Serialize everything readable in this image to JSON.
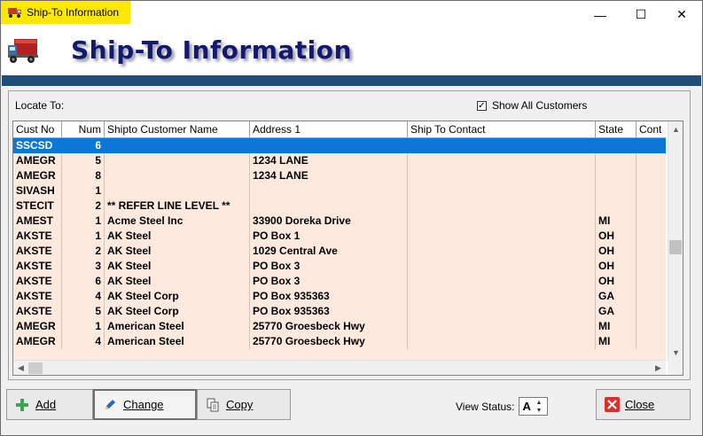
{
  "window": {
    "title": "Ship-To Information",
    "controls": {
      "minimize": "—",
      "maximize": "☐",
      "close": "✕"
    }
  },
  "header": {
    "title": "Ship-To Information"
  },
  "panel": {
    "locate_label": "Locate To:",
    "show_all_label": "Show All Customers",
    "show_all_checked": true,
    "show_all_mark": "✓"
  },
  "grid": {
    "columns": [
      "Cust No",
      "Num",
      "Shipto Customer Name",
      "Address 1",
      "Ship To Contact",
      "State",
      "Cont"
    ],
    "rows": [
      [
        "SSCSD",
        "6",
        "",
        "",
        "",
        "",
        ""
      ],
      [
        "AMEGR",
        "5",
        "",
        "1234 LANE",
        "",
        "",
        ""
      ],
      [
        "AMEGR",
        "8",
        "",
        "1234 LANE",
        "",
        "",
        ""
      ],
      [
        "SIVASH",
        "1",
        "",
        "",
        "",
        "",
        ""
      ],
      [
        "STECIT",
        "2",
        "** REFER LINE LEVEL **",
        "",
        "",
        "",
        ""
      ],
      [
        "AMEST",
        "1",
        "Acme Steel Inc",
        "33900 Doreka Drive",
        "",
        "MI",
        ""
      ],
      [
        "AKSTE",
        "1",
        "AK Steel",
        "PO Box 1",
        "",
        "OH",
        ""
      ],
      [
        "AKSTE",
        "2",
        "AK Steel",
        "1029 Central Ave",
        "",
        "OH",
        ""
      ],
      [
        "AKSTE",
        "3",
        "AK Steel",
        "PO Box 3",
        "",
        "OH",
        ""
      ],
      [
        "AKSTE",
        "6",
        "AK Steel",
        "PO Box 3",
        "",
        "OH",
        ""
      ],
      [
        "AKSTE",
        "4",
        "AK Steel Corp",
        "PO Box 935363",
        "",
        "GA",
        ""
      ],
      [
        "AKSTE",
        "5",
        "AK Steel Corp",
        "PO Box 935363",
        "",
        "GA",
        ""
      ],
      [
        "AMEGR",
        "1",
        "American Steel",
        "25770 Groesbeck Hwy",
        "",
        "MI",
        ""
      ],
      [
        "AMEGR",
        "4",
        "American Steel",
        "25770 Groesbeck Hwy",
        "",
        "MI",
        ""
      ]
    ],
    "selected_row": 0
  },
  "buttons": {
    "add": "Add",
    "change": "Change",
    "copy": "Copy",
    "close": "Close"
  },
  "view_status": {
    "label": "View Status:",
    "value": "A"
  },
  "colors": {
    "title_tab": "#ffe800",
    "header_title": "#131a6b",
    "header_bar": "#1f4e7a",
    "row_bg": "#fde9de",
    "selected_row": "#0b78d7"
  }
}
